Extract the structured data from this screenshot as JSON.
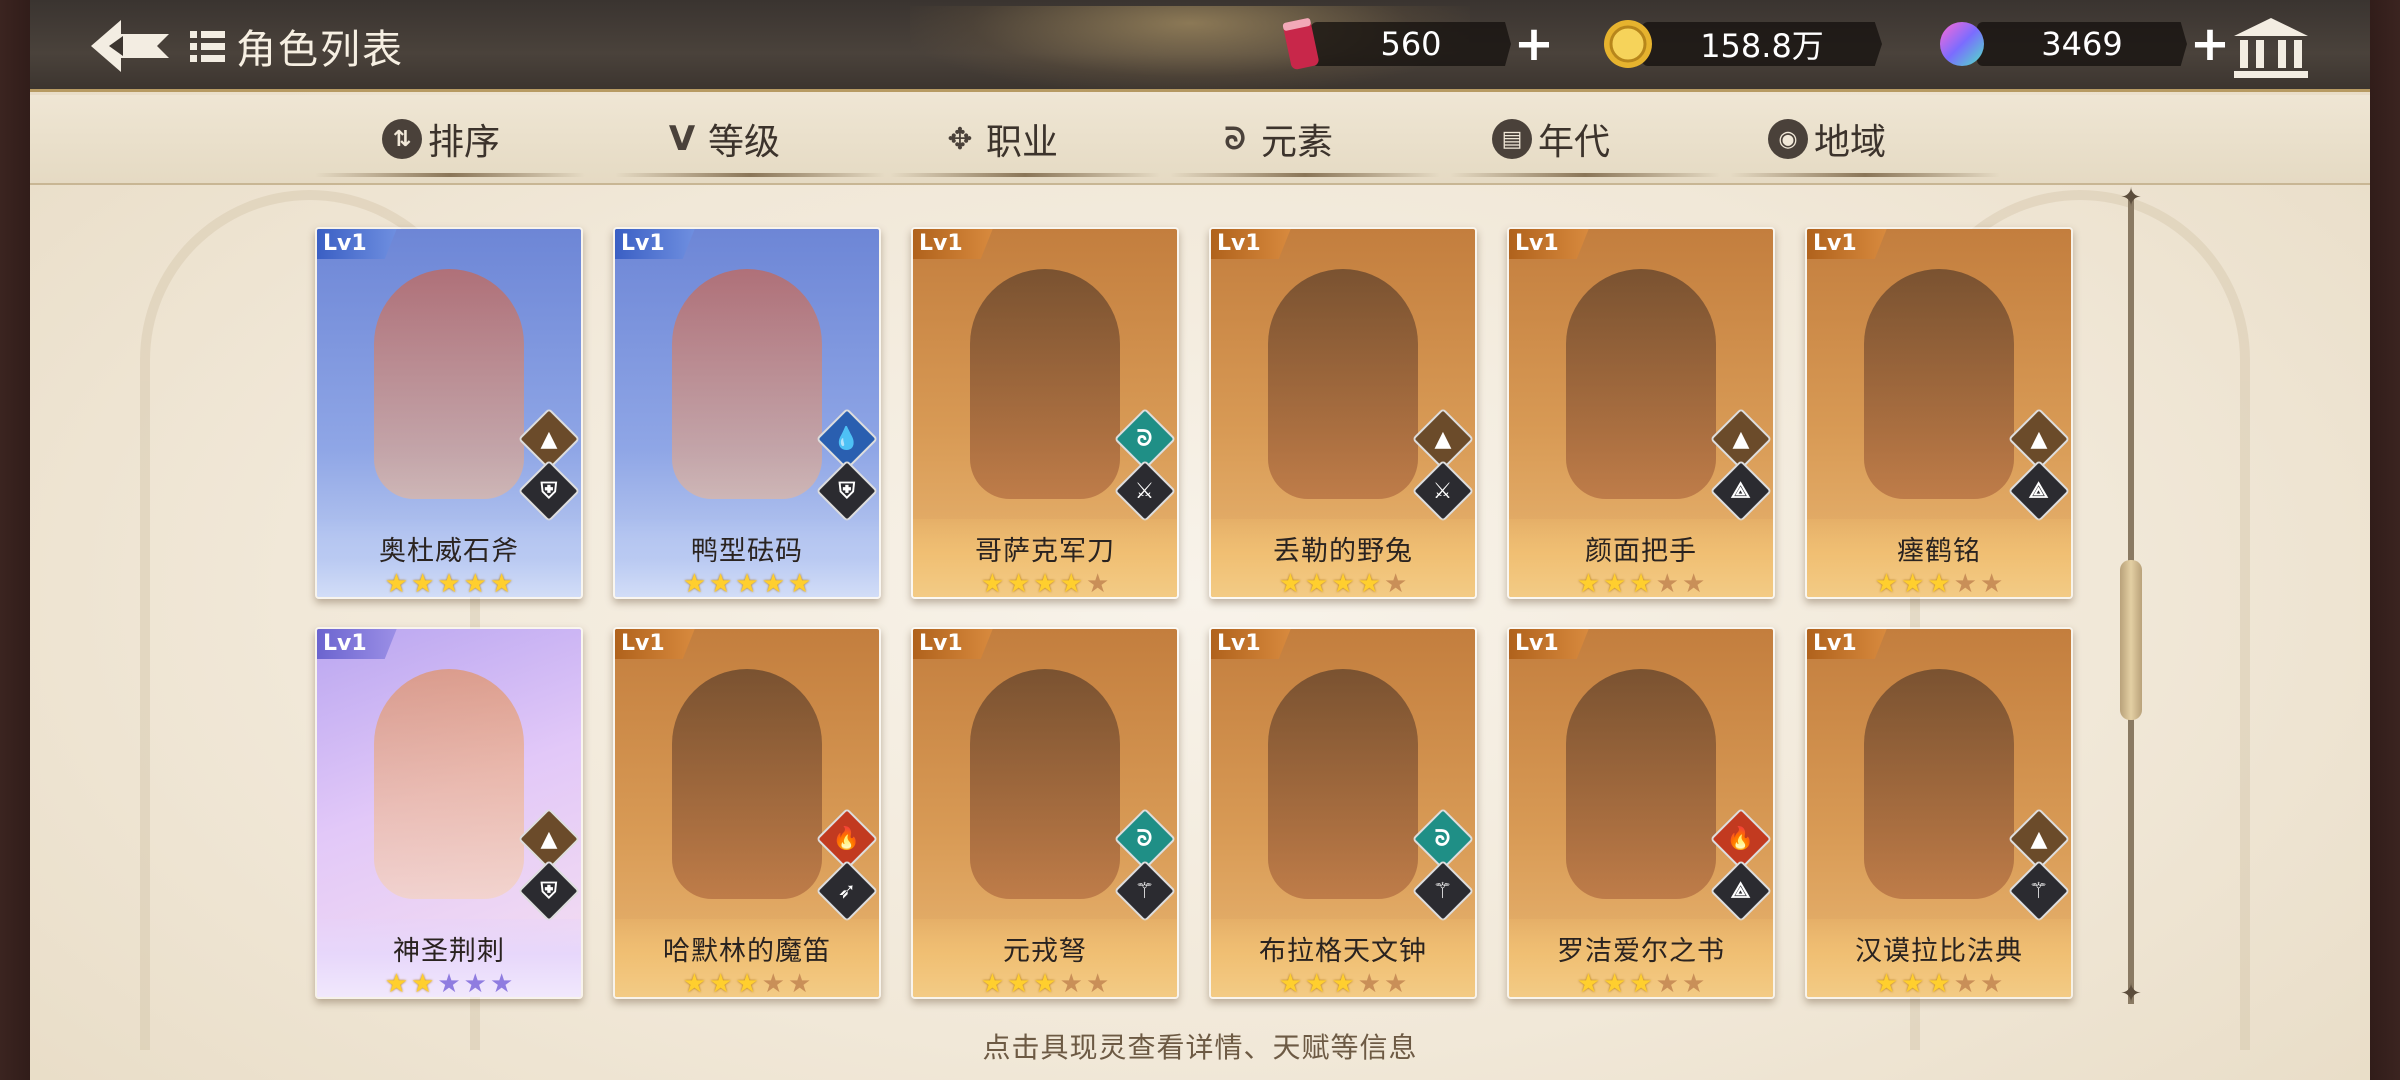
{
  "header": {
    "title": "角色列表",
    "back_icon": "back-arrow-icon",
    "list_icon": "list-icon"
  },
  "currencies": [
    {
      "name": "stamina",
      "icon": "can-icon",
      "value": "560"
    },
    {
      "name": "gold",
      "icon": "coin-icon",
      "value": "158.8万"
    },
    {
      "name": "gem",
      "icon": "gem-icon",
      "value": "3469"
    }
  ],
  "filters": [
    {
      "label": "排序",
      "icon": "sort-icon",
      "glyph": "⇅"
    },
    {
      "label": "等级",
      "icon": "level-icon",
      "glyph": "V"
    },
    {
      "label": "职业",
      "icon": "class-icon",
      "glyph": "✥"
    },
    {
      "label": "元素",
      "icon": "element-icon",
      "glyph": "ᘐ"
    },
    {
      "label": "年代",
      "icon": "era-icon",
      "glyph": "▤"
    },
    {
      "label": "地域",
      "icon": "region-icon",
      "glyph": "◉"
    }
  ],
  "cards": [
    {
      "level": "Lv1",
      "name": "奥杜威石斧",
      "rarity": "blue",
      "stars_on": 5,
      "stars_total": 5,
      "element": "earth",
      "class": "shield"
    },
    {
      "level": "Lv1",
      "name": "鸭型砝码",
      "rarity": "blue",
      "stars_on": 5,
      "stars_total": 5,
      "element": "water",
      "class": "shield"
    },
    {
      "level": "Lv1",
      "name": "哥萨克军刀",
      "rarity": "gold",
      "stars_on": 4,
      "stars_total": 5,
      "element": "wind",
      "class": "swords"
    },
    {
      "level": "Lv1",
      "name": "丢勒的野兔",
      "rarity": "gold",
      "stars_on": 4,
      "stars_total": 5,
      "element": "earth",
      "class": "swords"
    },
    {
      "level": "Lv1",
      "name": "颜面把手",
      "rarity": "gold",
      "stars_on": 3,
      "stars_total": 5,
      "element": "earth",
      "class": "book"
    },
    {
      "level": "Lv1",
      "name": "瘗鹤铭",
      "rarity": "gold",
      "stars_on": 3,
      "stars_total": 5,
      "element": "earth",
      "class": "book"
    },
    {
      "level": "Lv1",
      "name": "神圣荆刺",
      "rarity": "purple",
      "stars_on": 2,
      "stars_total": 5,
      "element": "earth",
      "class": "shield"
    },
    {
      "level": "Lv1",
      "name": "哈默林的魔笛",
      "rarity": "gold",
      "stars_on": 3,
      "stars_total": 5,
      "element": "fire",
      "class": "bow"
    },
    {
      "level": "Lv1",
      "name": "元戎弩",
      "rarity": "gold",
      "stars_on": 3,
      "stars_total": 5,
      "element": "wind",
      "class": "staff"
    },
    {
      "level": "Lv1",
      "name": "布拉格天文钟",
      "rarity": "gold",
      "stars_on": 3,
      "stars_total": 5,
      "element": "wind",
      "class": "staff"
    },
    {
      "level": "Lv1",
      "name": "罗洁爱尔之书",
      "rarity": "gold",
      "stars_on": 3,
      "stars_total": 5,
      "element": "fire",
      "class": "book"
    },
    {
      "level": "Lv1",
      "name": "汉谟拉比法典",
      "rarity": "gold",
      "stars_on": 3,
      "stars_total": 5,
      "element": "earth",
      "class": "staff"
    }
  ],
  "hint": "点击具现灵查看详情、天赋等信息",
  "colors": {
    "element_earth": "#6b4b2a",
    "element_water": "#2a5fb0",
    "element_wind": "#1f8f86",
    "element_fire": "#c23a20"
  }
}
